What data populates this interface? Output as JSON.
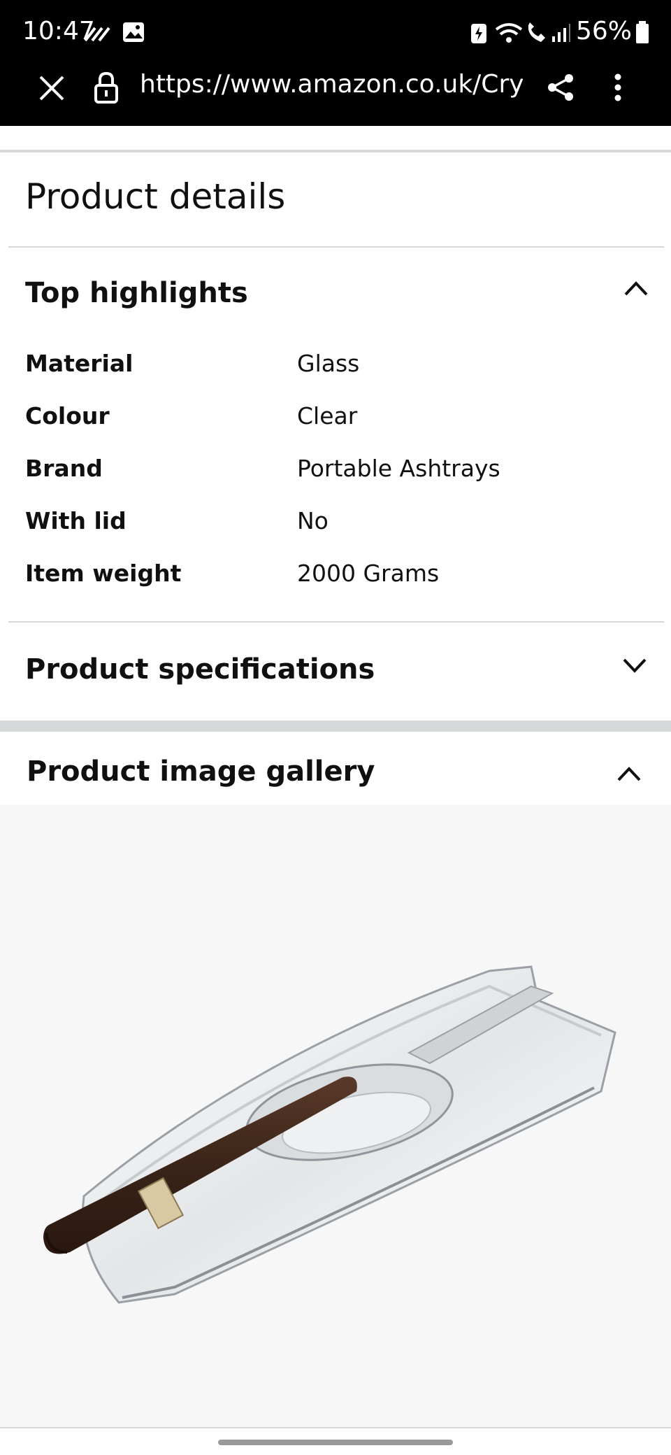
{
  "status_bar": {
    "time": "10:47",
    "battery": "56%"
  },
  "browser": {
    "url": "https://www.amazon.co.uk/Cryst",
    "icons": [
      "close-icon",
      "lock-icon",
      "share-icon",
      "more-vert-icon"
    ]
  },
  "page": {
    "title": "Product details",
    "top_highlights": {
      "heading": "Top highlights",
      "rows": [
        {
          "label": "Material",
          "value": "Glass"
        },
        {
          "label": "Colour",
          "value": "Clear"
        },
        {
          "label": "Brand",
          "value": "Portable Ashtrays"
        },
        {
          "label": "With lid",
          "value": "No"
        },
        {
          "label": "Item weight",
          "value": "2000 Grams"
        }
      ]
    },
    "specifications": {
      "heading": "Product specifications"
    },
    "gallery": {
      "heading": "Product image gallery"
    }
  },
  "colors": {
    "background": "#ffffff",
    "topbar": "#000000",
    "divider": "#d5d9d9",
    "text": "#0f1111",
    "gallery_bg": "#f7f7f7"
  }
}
